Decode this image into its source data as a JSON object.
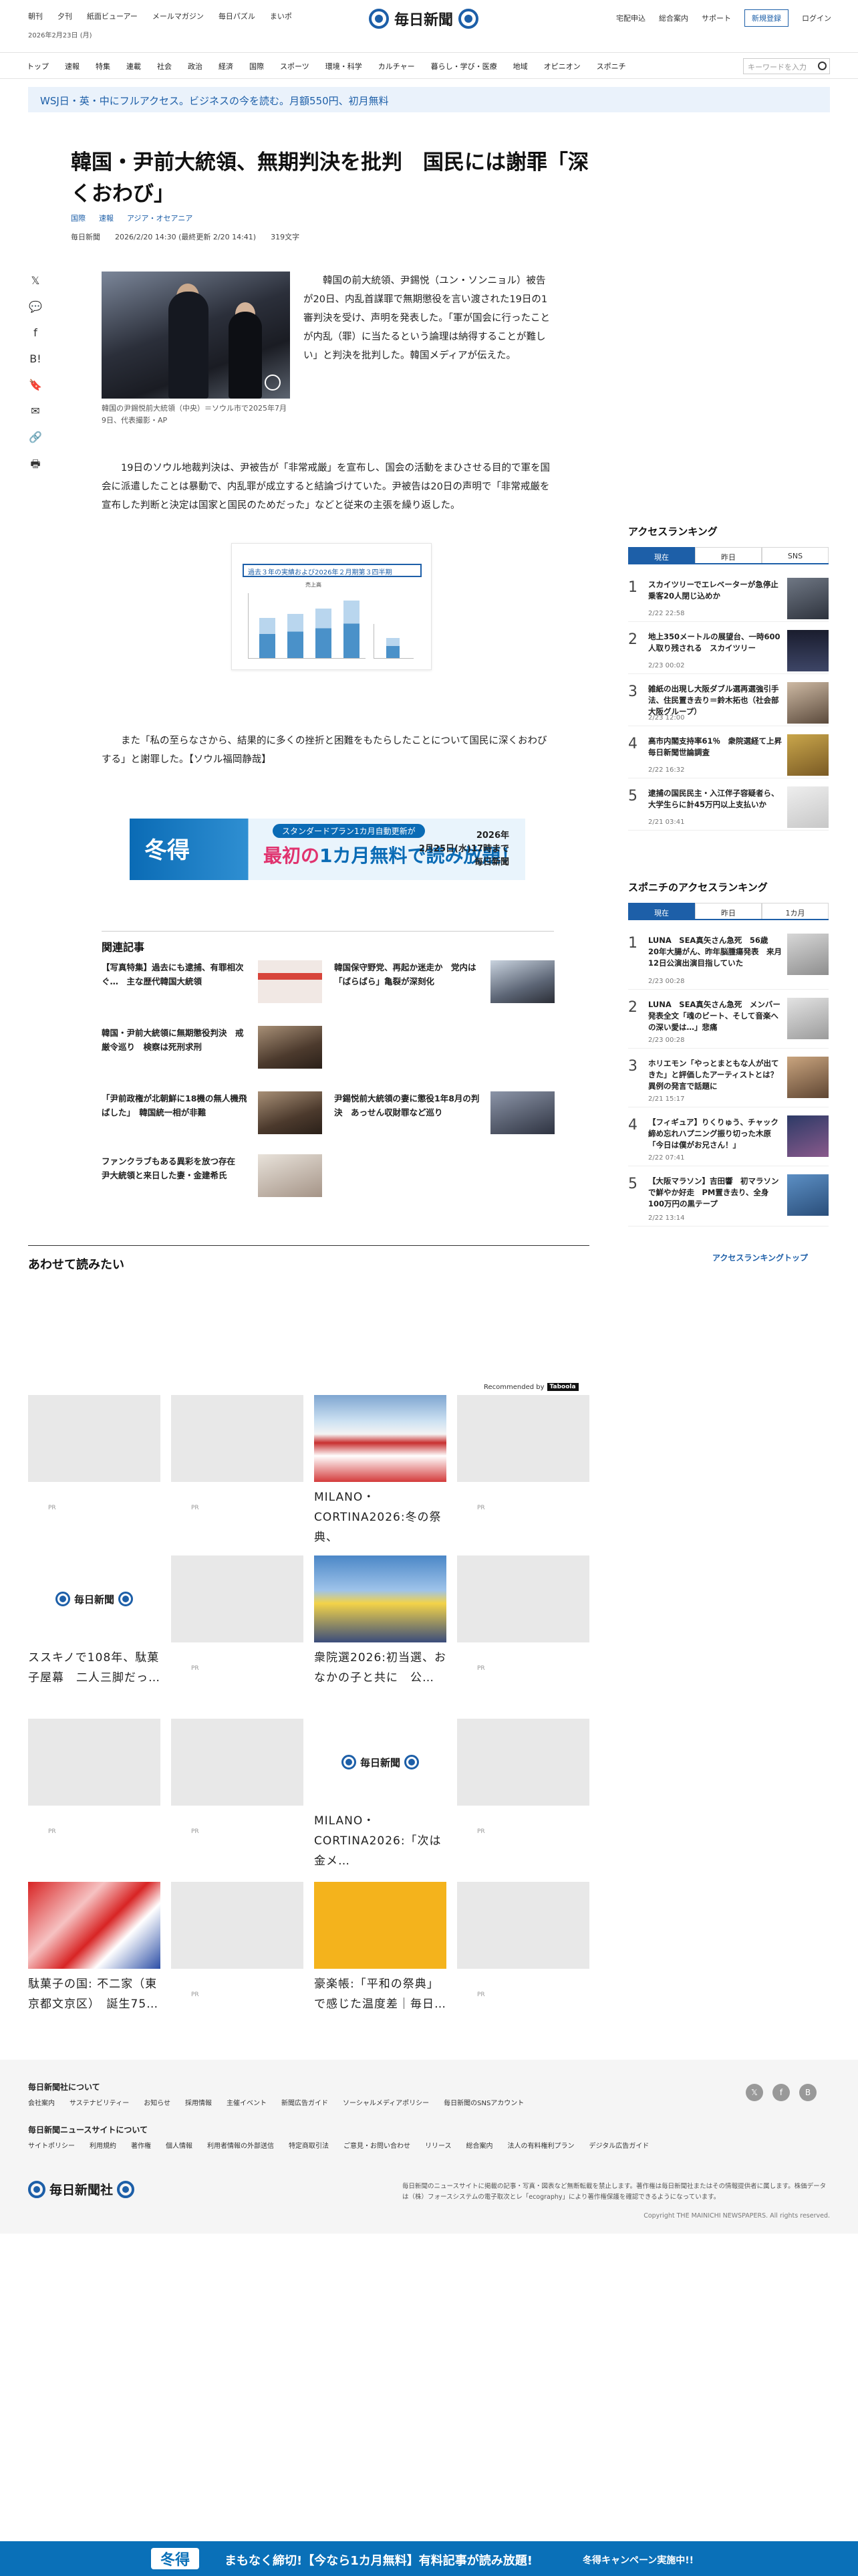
{
  "header": {
    "links": [
      "朝刊",
      "夕刊",
      "紙面ビューアー",
      "メールマガジン",
      "毎日パズル",
      "まいポ"
    ],
    "date": "2026年2月23日 (月)",
    "logo": "毎日新聞",
    "right_links": [
      "宅配申込",
      "総合案内",
      "サポート"
    ],
    "register": "新規登録",
    "login": "ログイン"
  },
  "nav": {
    "items": [
      "トップ",
      "速報",
      "特集",
      "連載",
      "社会",
      "政治",
      "経済",
      "国際",
      "スポーツ",
      "環境・科学",
      "カルチャー",
      "暮らし・学び・医療",
      "地域",
      "オピニオン",
      "スポニチ"
    ],
    "search_placeholder": "キーワードを入力"
  },
  "promo": {
    "text": "WSJ日・英・中にフルアクセス。ビジネスの今を読む。月額550円、初月無料"
  },
  "article": {
    "headline": "韓国・尹前大統領、無期判決を批判　国民には謝罪「深くおわび」",
    "tags": [
      "国際",
      "速報",
      "アジア・オセアニア"
    ],
    "source": "毎日新聞",
    "published": "2026/2/20 14:30 (最終更新 2/20 14:41)",
    "length": "319文字",
    "photo_caption": "韓国の尹錫悦前大統領（中央）＝ソウル市で2025年7月9日、代表撮影・AP",
    "p1": "韓国の前大統領、尹錫悦（ユン・ソンニョル）被告が20日、内乱首謀罪で無期懲役を言い渡された19日の1審判決を受け、声明を発表した。「軍が国会に行ったことが内乱（罪）に当たるという論理は納得することが難しい」と判決を批判した。韓国メディアが伝えた。",
    "p2": "19日のソウル地裁判決は、尹被告が「非常戒厳」を宣布し、国会の活動をまひさせる目的で軍を国会に派遣したことは暴動で、内乱罪が成立すると結論づけていた。尹被告は20日の声明で「非常戒厳を宣布した判断と決定は国家と国民のためだった」などと従来の主張を繰り返した。",
    "doc_head": "過去３年の実績および2026年２月期第３四半期",
    "doc_sub": "売上高",
    "p3": "また「私の至らなさから、結果的に多くの挫折と困難をもたらしたことについて国民に深くおわびする」と謝罪した。【ソウル福岡静哉】"
  },
  "banner": {
    "winter": "冬得",
    "top": "スタンダードプラン1カ月自動更新が",
    "main_prefix": "最初の",
    "main": "1カ月無料で読み放題！",
    "date_line1": "2026年",
    "date_line2": "2月25日(水)17時まで",
    "logo": "毎日新聞"
  },
  "related": {
    "title": "関連記事",
    "items": [
      "【写真特集】過去にも逮捕、有罪相次ぐ…　主な歴代韓国大統領",
      "韓国保守野党、再起か迷走か　党内は「ばらばら」亀裂が深刻化",
      "韓国・尹前大統領に無期懲役判決　戒厳令巡り　検察は死刑求刑",
      "「尹前政権が北朝鮮に18機の無人機飛ばした」　韓国統一相が非難",
      "尹錫悦前大統領の妻に懲役1年8月の判決　あっせん収財罪など巡り",
      "ファンクラブもある異彩を放つ存在　尹大統領と来日した妻・金建希氏"
    ]
  },
  "ranking": {
    "title": "アクセスランキング",
    "tabs": [
      "現在",
      "昨日",
      "SNS"
    ],
    "items": [
      {
        "text": "スカイツリーでエレベーターが急停止　乗客20人閉じ込めか",
        "date": "2/22 22:58"
      },
      {
        "text": "地上350メートルの展望台、一時600人取り残される　スカイツリー",
        "date": "2/23 00:02"
      },
      {
        "text": "雑紙の出現し大阪ダブル選再選強引手法、住民置き去り＝鈴木拓也（社会部大阪グループ）",
        "date": "2/23 12:00"
      },
      {
        "text": "高市内閣支持率61％　衆院選経て上昇　毎日新聞世論調査",
        "date": "2/22 16:32"
      },
      {
        "text": "逮捕の国民民主・入江伴子容疑者ら、大学生らに計45万円以上支払いか",
        "date": "2/21 03:41"
      }
    ],
    "more": "アクセスランキングトップ"
  },
  "sponichi": {
    "title": "スポニチのアクセスランキング",
    "tabs": [
      "現在",
      "昨日",
      "1カ月"
    ],
    "items": [
      {
        "text": "LUNA　SEA真矢さん急死　56歳　20年大腸がん、昨年脳腫瘍発表　来月12日公演出演目指していた",
        "date": "2/23 00:28"
      },
      {
        "text": "LUNA　SEA真矢さん急死　メンバー発表全文「魂のビート、そして音楽への深い愛は…」悲痛",
        "date": "2/23 00:28"
      },
      {
        "text": "ホリエモン「やっとまともな人が出てきた」と評価したアーティストとは？異例の発言で話題に",
        "date": "2/21 15:17"
      },
      {
        "text": "【フィギュア】りくりゅう、チャック締め忘れハプニング振り切った木原「今日は僕がお兄さん！」",
        "date": "2/22 07:41"
      },
      {
        "text": "【大阪マラソン】吉田響　初マラソンで鮮やか好走　PM置き去り、全身100万円の黒テープ",
        "date": "2/22 13:14"
      }
    ],
    "more": "アクセスランキングトップ"
  },
  "also": {
    "title": "あわせて読みたい",
    "recommended": "Recommended by",
    "taboola": "Taboola",
    "pr": "PR",
    "cards": [
      {
        "title": ""
      },
      {
        "title": ""
      },
      {
        "title": "MILANO・CORTINA2026:冬の祭典、"
      },
      {
        "title": ""
      },
      {
        "title": "ススキノで108年、駄菓子屋幕　二人三脚だっ…"
      },
      {
        "title": ""
      },
      {
        "title": "衆院選2026:初当選、おなかの子と共に　公…"
      },
      {
        "title": ""
      },
      {
        "title": ""
      },
      {
        "title": ""
      },
      {
        "title": "MILANO・CORTINA2026:「次は金メ…"
      },
      {
        "title": ""
      },
      {
        "title": "駄菓子の国: 不二家（東京都文京区）　誕生75…"
      },
      {
        "title": ""
      },
      {
        "title": "豪楽帳:「平和の祭典」で感じた温度差｜毎日…"
      },
      {
        "title": ""
      }
    ]
  },
  "footer": {
    "head1": "毎日新聞社について",
    "links1": [
      "会社案内",
      "サステナビリティー",
      "お知らせ",
      "採用情報",
      "主催イベント",
      "新聞広告ガイド",
      "ソーシャルメディアポリシー",
      "毎日新聞のSNSアカウント"
    ],
    "head2": "毎日新聞ニュースサイトについて",
    "links2": [
      "サイトポリシー",
      "利用規約",
      "著作権",
      "個人情報",
      "利用者情報の外部送信",
      "特定商取引法",
      "ご意見・お問い合わせ",
      "リリース",
      "総合案内",
      "法人の有料権利プラン",
      "デジタル広告ガイド"
    ],
    "logo": "毎日新聞社",
    "note": "毎日新聞のニュースサイトに掲載の記事・写真・図表など無断転載を禁止します。著作権は毎日新聞社またはその情報提供者に属します。株価データは（株）フォースシステムの電子取次とレ「ecography」により著作権保護を確認できるようになっています。",
    "copyright": "Copyright THE MAINICHI NEWSPAPERS. All rights reserved."
  },
  "bottombar": {
    "winter": "冬得",
    "text": "まもなく締切!【今なら1カ月無料】有料記事が読み放題!",
    "campaign": "冬得キャンペーン実施中!!"
  }
}
